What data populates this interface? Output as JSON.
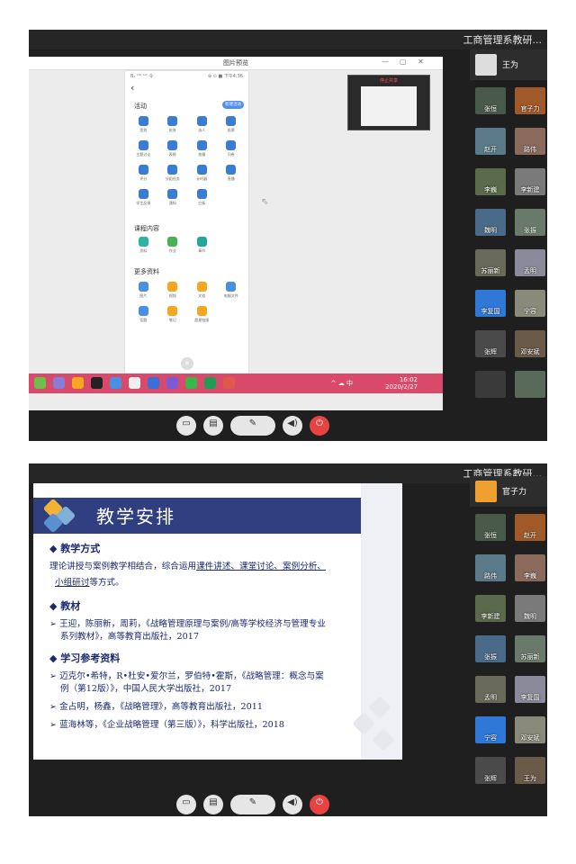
{
  "screen1": {
    "meeting_title": "工商管理系教研...",
    "preview_title": "图片预览",
    "phone": {
      "status_left": "B₄ ᵗᵃˡˡ ᵗᵃˡˡ 令",
      "status_right": "⊕ ⊙ ■ 下午4:36",
      "back": "‹",
      "section_activity": "活动",
      "new_activity": "新建活动",
      "activity_items": [
        "签到",
        "抢答",
        "选人",
        "投票",
        "主题讨论",
        "表格",
        "拍摄",
        "问卷",
        "评分",
        "分组任务",
        "计时器",
        "直播",
        "学生反馈",
        "通知",
        "白板"
      ],
      "section_course": "课程内容",
      "course_items": [
        "资料",
        "作业",
        "章节"
      ],
      "section_more": "更多资料",
      "more_items": [
        "图片",
        "视频",
        "文档",
        "电脑文件",
        "话题",
        "笔记",
        "超星链接"
      ],
      "close": "×",
      "nav": [
        "←",
        "→",
        "⤓",
        "⊡",
        "↻"
      ]
    },
    "pip_label": "停止共享",
    "taskbar": {
      "ime": "^ ☁ 中",
      "time": "16:02",
      "date": "2020/2/27"
    },
    "sidebar_me": "王为",
    "participants": [
      "张恒",
      "官子力",
      "赵开",
      "路伟",
      "李巍",
      "李新建",
      "魏明",
      "张振",
      "苏丽新",
      "孟明",
      "李复国",
      "宁容",
      "张辉",
      "邓安斌",
      "",
      ""
    ],
    "controls": [
      "▭",
      "▤",
      "✎",
      "◀)",
      "⏻"
    ]
  },
  "screen2": {
    "meeting_title": "工商管理系教研...",
    "slide": {
      "title": "教学安排",
      "h1": "◆ 教学方式",
      "p1a": "理论讲授与案例教学相结合，综合运用",
      "p1b": "课件讲述、课堂讨论、案例分析、",
      "p1c": "小组研讨",
      "p1d": "等方式。",
      "h2": "◆ 教材",
      "b2a": "➢ 王迎，陈丽新，周莉，《战略管理原理与案例/高等学校经济与管理专业",
      "b2b": "系列教材》，高等教育出版社，2017",
      "h3": "◆ 学习参考资料",
      "b3a": "➢ 迈克尔•希特，R•杜安•爱尔兰，罗伯特•霍斯，《战略管理：概念与案",
      "b3b": "例（第12版）》，中国人民大学出版社，2017",
      "b3c": "➢ 金占明，杨鑫，《战略管理》，高等教育出版社，2011",
      "b3d": "➢ 蓝海林等，《企业战略管理（第三版）》，科学出版社，2018"
    },
    "sidebar_me": "官子力",
    "participants": [
      "张恒",
      "赵开",
      "路伟",
      "李巍",
      "李新建",
      "魏明",
      "张振",
      "苏丽新",
      "孟明",
      "李复国",
      "宁容",
      "邓安斌",
      "张辉",
      "王为"
    ],
    "controls": [
      "▭",
      "▤",
      "✎",
      "◀)",
      "⏻"
    ]
  },
  "colors": {
    "accent_blue": "#4d8ef7",
    "taskbar": "#d94a6a",
    "slide_band": "#2f3f7f",
    "hangup": "#e84343"
  }
}
